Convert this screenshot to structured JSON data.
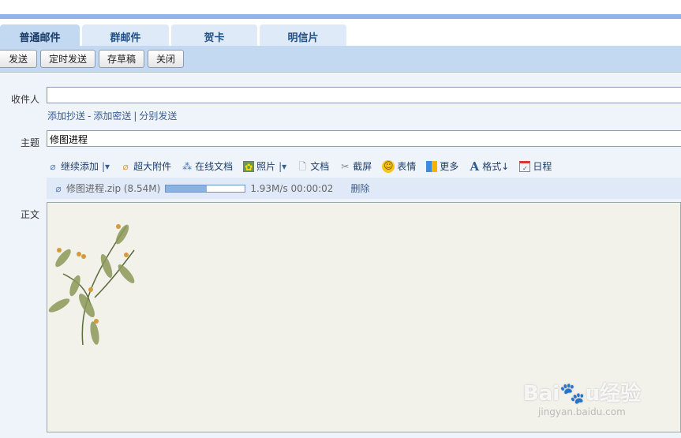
{
  "tabs": [
    {
      "label": "普通邮件"
    },
    {
      "label": "群邮件"
    },
    {
      "label": "贺卡"
    },
    {
      "label": "明信片"
    }
  ],
  "toolbar": {
    "send": "发送",
    "scheduled_send": "定时发送",
    "save_draft": "存草稿",
    "close": "关闭"
  },
  "form": {
    "to_label": "收件人",
    "to_value": "",
    "links": [
      "添加抄送",
      "-",
      "添加密送",
      "|",
      "分别发送"
    ],
    "subject_label": "主题",
    "subject_value": "修图进程",
    "body_label": "正文"
  },
  "attach_toolbar": [
    {
      "label": "继续添加",
      "icon": "paperclip-icon"
    },
    {
      "label": "超大附件",
      "icon": "paperclip-orange-icon"
    },
    {
      "label": "在线文档",
      "icon": "share-nodes-icon"
    },
    {
      "label": "照片",
      "icon": "photo-icon"
    },
    {
      "label": "文档",
      "icon": "document-icon"
    },
    {
      "label": "截屏",
      "icon": "scissors-icon"
    },
    {
      "label": "表情",
      "icon": "smiley-icon"
    },
    {
      "label": "更多",
      "icon": "grid-icon"
    },
    {
      "label": "格式↓",
      "icon": "font-icon"
    },
    {
      "label": "日程",
      "icon": "calendar-icon"
    }
  ],
  "attachment": {
    "name": "修图进程.zip (8.54M)",
    "progress_percent": 52,
    "speed": "1.93M/s 00:00:02",
    "delete": "删除"
  },
  "watermark": {
    "text": "Baidu经验",
    "url": "jingyan.baidu.com"
  }
}
